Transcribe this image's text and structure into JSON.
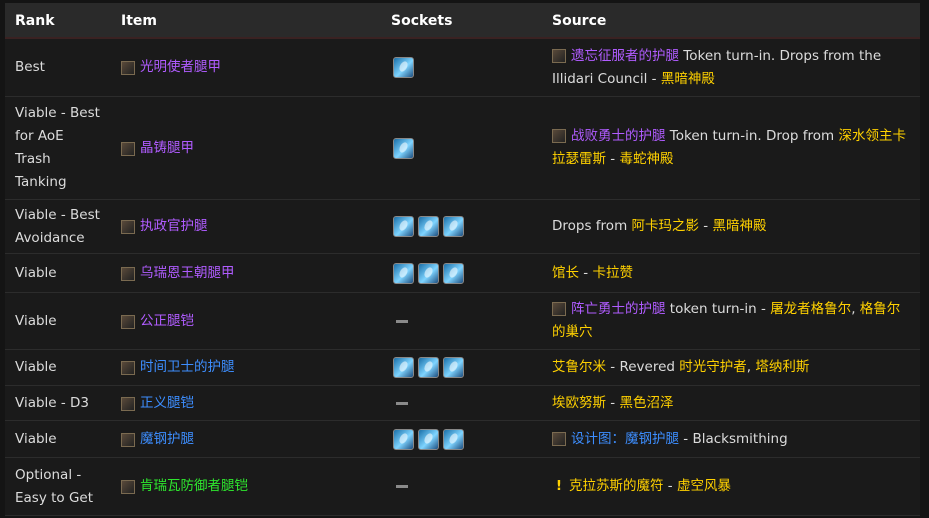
{
  "headers": {
    "rank": "Rank",
    "item": "Item",
    "sockets": "Sockets",
    "source": "Source"
  },
  "rows": [
    {
      "rank": "Best",
      "item": "光明使者腿甲",
      "item_quality": "epic",
      "sockets": 1,
      "source": [
        {
          "t": "icon"
        },
        {
          "t": "text",
          "v": "遗忘征服者的护腿",
          "c": "epic"
        },
        {
          "t": "text",
          "v": " Token turn-in. Drops from the Illidari Council - "
        },
        {
          "t": "text",
          "v": "黑暗神殿",
          "c": "gold"
        }
      ]
    },
    {
      "rank": "Viable - Best for AoE Trash Tanking",
      "item": "晶铸腿甲",
      "item_quality": "epic",
      "sockets": 1,
      "source": [
        {
          "t": "icon"
        },
        {
          "t": "text",
          "v": "战败勇士的护腿",
          "c": "epic"
        },
        {
          "t": "text",
          "v": " Token turn-in. Drop from "
        },
        {
          "t": "text",
          "v": "深水领主卡拉瑟雷斯",
          "c": "gold"
        },
        {
          "t": "text",
          "v": " - "
        },
        {
          "t": "text",
          "v": "毒蛇神殿",
          "c": "gold"
        }
      ]
    },
    {
      "rank": "Viable - Best Avoidance",
      "item": "执政官护腿",
      "item_quality": "epic",
      "sockets": 3,
      "source": [
        {
          "t": "text",
          "v": "Drops from "
        },
        {
          "t": "text",
          "v": "阿卡玛之影",
          "c": "gold"
        },
        {
          "t": "text",
          "v": " - "
        },
        {
          "t": "text",
          "v": "黑暗神殿",
          "c": "gold"
        }
      ]
    },
    {
      "rank": "Viable",
      "item": "乌瑞恩王朝腿甲",
      "item_quality": "epic",
      "sockets": 3,
      "source": [
        {
          "t": "text",
          "v": "馆长",
          "c": "gold"
        },
        {
          "t": "text",
          "v": " - "
        },
        {
          "t": "text",
          "v": "卡拉赞",
          "c": "gold"
        }
      ]
    },
    {
      "rank": "Viable",
      "item": "公正腿铠",
      "item_quality": "epic",
      "sockets": 0,
      "source": [
        {
          "t": "icon"
        },
        {
          "t": "text",
          "v": "阵亡勇士的护腿",
          "c": "epic"
        },
        {
          "t": "text",
          "v": " token turn-in - "
        },
        {
          "t": "text",
          "v": "屠龙者格鲁尔",
          "c": "gold"
        },
        {
          "t": "text",
          "v": ", "
        },
        {
          "t": "text",
          "v": "格鲁尔的巢穴",
          "c": "gold"
        }
      ]
    },
    {
      "rank": "Viable",
      "item": "时间卫士的护腿",
      "item_quality": "rare",
      "sockets": 3,
      "source": [
        {
          "t": "text",
          "v": "艾鲁尔米",
          "c": "gold"
        },
        {
          "t": "text",
          "v": " - Revered "
        },
        {
          "t": "text",
          "v": "时光守护者",
          "c": "gold"
        },
        {
          "t": "text",
          "v": ", "
        },
        {
          "t": "text",
          "v": "塔纳利斯",
          "c": "gold"
        }
      ]
    },
    {
      "rank": "Viable - D3",
      "item": "正义腿铠",
      "item_quality": "rare",
      "sockets": 0,
      "source": [
        {
          "t": "text",
          "v": "埃欧努斯",
          "c": "gold"
        },
        {
          "t": "text",
          "v": " - "
        },
        {
          "t": "text",
          "v": "黑色沼泽",
          "c": "gold"
        }
      ]
    },
    {
      "rank": "Viable",
      "item": "魔钢护腿",
      "item_quality": "rare",
      "sockets": 3,
      "source": [
        {
          "t": "icon"
        },
        {
          "t": "text",
          "v": "设计图：魔钢护腿",
          "c": "rare"
        },
        {
          "t": "text",
          "v": " - Blacksmithing"
        }
      ]
    },
    {
      "rank": "Optional - Easy to Get",
      "item": "肯瑞瓦防御者腿铠",
      "item_quality": "uncommon",
      "sockets": 0,
      "source": [
        {
          "t": "quest",
          "v": "!"
        },
        {
          "t": "text",
          "v": "克拉苏斯的魔符",
          "c": "gold"
        },
        {
          "t": "text",
          "v": " - "
        },
        {
          "t": "text",
          "v": "虚空风暴",
          "c": "gold"
        }
      ]
    }
  ]
}
